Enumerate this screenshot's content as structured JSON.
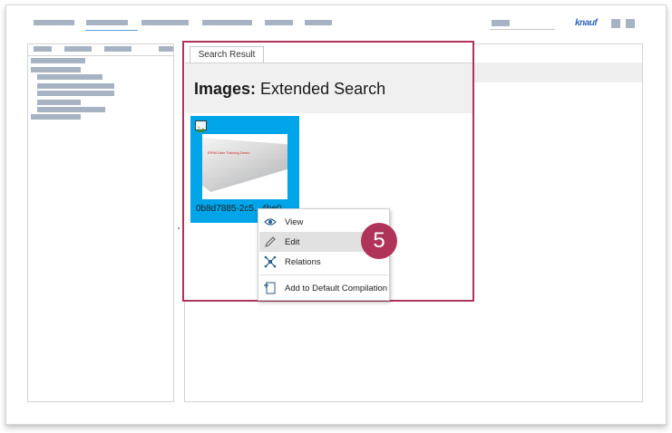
{
  "app": {
    "brand": "knauf"
  },
  "tab": {
    "label": "Search Result"
  },
  "header": {
    "title_bold": "Images:",
    "title_rest": "Extended Search"
  },
  "tile": {
    "label": "0b8d7885-2c5...4be0",
    "thumbnail_caption": "EPIM User Training Demo"
  },
  "context_menu": {
    "items": [
      {
        "label": "View",
        "icon": "eye-icon"
      },
      {
        "label": "Edit",
        "icon": "pencil-icon"
      },
      {
        "label": "Relations",
        "icon": "relations-icon"
      },
      {
        "label": "Add to Default Compilation",
        "icon": "compilation-icon"
      }
    ]
  },
  "step_badge": {
    "number": "5"
  },
  "colors": {
    "accent": "#00a4e8",
    "highlight": "#b0335a",
    "placeholder": "#a7b3c2"
  }
}
